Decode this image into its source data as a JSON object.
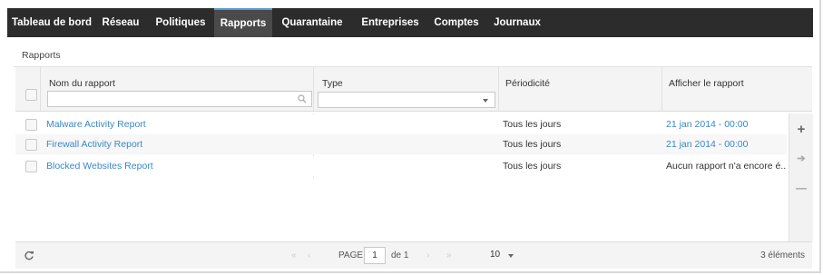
{
  "nav": {
    "tabs": [
      {
        "label": "Tableau de bord"
      },
      {
        "label": "Réseau"
      },
      {
        "label": "Politiques"
      },
      {
        "label": "Rapports"
      },
      {
        "label": "Quarantaine"
      },
      {
        "label": "Entreprises"
      },
      {
        "label": "Comptes"
      },
      {
        "label": "Journaux"
      }
    ],
    "active": "Rapports"
  },
  "breadcrumb": "Rapports",
  "table": {
    "columns": [
      {
        "label": "Nom du rapport"
      },
      {
        "label": "Type"
      },
      {
        "label": "Périodicité"
      },
      {
        "label": "Afficher le rapport"
      }
    ],
    "filters": {
      "name_value": "",
      "type_value": ""
    },
    "rows": [
      {
        "name": "Malware Activity Report",
        "type": "",
        "periodicity": "Tous les jours",
        "view": "21 jan 2014 - 00:00",
        "view_is_link": true
      },
      {
        "name": "Firewall Activity Report",
        "type": "",
        "periodicity": "Tous les jours",
        "view": "21 jan 2014 - 00:00",
        "view_is_link": true
      },
      {
        "name": "Blocked Websites Report",
        "type": "",
        "periodicity": "Tous les jours",
        "view": "Aucun rapport n'a encore é...",
        "view_is_link": false
      }
    ]
  },
  "side_buttons": {
    "add": "+",
    "download": "➔",
    "remove": "—"
  },
  "footer": {
    "refresh_icon": "refresh-icon",
    "first_icon": "«",
    "prev_icon": "‹",
    "page_label": "PAGE",
    "page_value": "1",
    "of_label": "de 1",
    "next_icon": "›",
    "last_icon": "»",
    "per_page": "10",
    "count": "3 éléments"
  },
  "colors": {
    "nav_bg": "#2c2c2c",
    "active_tab_bg": "#4a4a4a",
    "link": "#3a87c8"
  }
}
